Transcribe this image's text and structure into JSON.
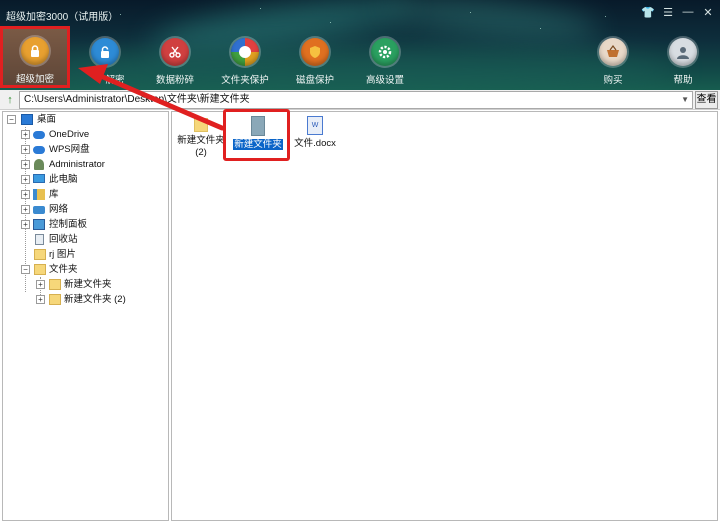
{
  "app": {
    "title": "超级加密3000（试用版）"
  },
  "window_controls": {
    "skin": "👕",
    "menu": "☰",
    "minimize": "—",
    "close": "✕"
  },
  "toolbar": {
    "items": [
      {
        "label": "超级加密",
        "icon": "lock-icon",
        "color": "#e8a030"
      },
      {
        "label": "解密",
        "icon": "unlock-icon",
        "color": "#2d8bd6"
      },
      {
        "label": "数据粉碎",
        "icon": "scissors-icon",
        "color": "#d04040"
      },
      {
        "label": "文件夹保护",
        "icon": "folder-protect-icon",
        "color": "#e0a020"
      },
      {
        "label": "磁盘保护",
        "icon": "shield-icon",
        "color": "#e07020"
      },
      {
        "label": "高级设置",
        "icon": "gear-icon",
        "color": "#2aa060"
      },
      {
        "label": "购买",
        "icon": "cart-icon",
        "color": "#c08040"
      },
      {
        "label": "帮助",
        "icon": "user-help-icon",
        "color": "#5a6a78"
      }
    ]
  },
  "address_bar": {
    "path": "C:\\Users\\Administrator\\Desktop\\文件夹\\新建文件夹",
    "go_label": "查看"
  },
  "tree": {
    "root": "桌面",
    "items": [
      {
        "label": "OneDrive"
      },
      {
        "label": "WPS网盘"
      },
      {
        "label": "Administrator"
      },
      {
        "label": "此电脑"
      },
      {
        "label": "库"
      },
      {
        "label": "网络"
      },
      {
        "label": "控制面板"
      },
      {
        "label": "回收站"
      },
      {
        "label": "rj 图片"
      },
      {
        "label": "文件夹"
      }
    ],
    "children": [
      {
        "label": "新建文件夹"
      },
      {
        "label": "新建文件夹 (2)"
      }
    ]
  },
  "files": [
    {
      "label": "新建文件夹 (2)",
      "type": "folder",
      "selected": false
    },
    {
      "label": "新建文件夹",
      "type": "folder",
      "selected": true
    },
    {
      "label": "文件.docx",
      "type": "docx",
      "selected": false
    }
  ],
  "colors": {
    "highlight_red": "#e02020",
    "selection_blue": "#0a64c8",
    "folder_yellow": "#f6d77a"
  }
}
